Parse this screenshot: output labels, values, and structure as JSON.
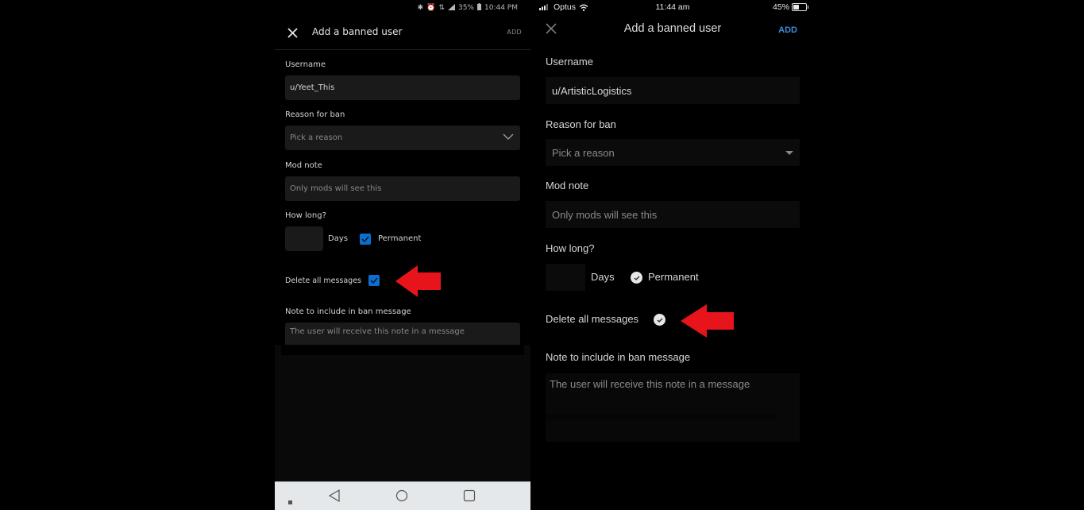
{
  "android": {
    "status_bar": {
      "icons": [
        "bluetooth-icon",
        "alarm-icon",
        "data-icon",
        "signal-icon"
      ],
      "battery": "35%",
      "time": "10:44 PM"
    },
    "header": {
      "close_icon": "close-icon",
      "title": "Add a banned user",
      "add_label": "ADD"
    },
    "form": {
      "username_label": "Username",
      "username_value": "u/Yeet_This",
      "reason_label": "Reason for ban",
      "reason_placeholder": "Pick a reason",
      "mod_note_label": "Mod note",
      "mod_note_placeholder": "Only mods will see this",
      "how_long_label": "How long?",
      "days_value": "",
      "days_label": "Days",
      "permanent_label": "Permanent",
      "permanent_checked": true,
      "delete_messages_label": "Delete all messages",
      "delete_messages_checked": true,
      "note_label": "Note to include in ban message",
      "note_placeholder": "The user will receive this note in a message"
    },
    "nav_bar": [
      "menu-dot",
      "back-icon",
      "home-icon",
      "recents-icon"
    ],
    "colors": {
      "checkbox": "#0c6fcf",
      "arrow": "#e8141c"
    }
  },
  "ios": {
    "status_bar": {
      "carrier": "Optus",
      "time": "11:44 am",
      "battery": "45%",
      "battery_fraction": 0.45
    },
    "header": {
      "close_icon": "close-icon",
      "title": "Add a banned user",
      "add_label": "ADD"
    },
    "form": {
      "username_label": "Username",
      "username_value": "u/ArtisticLogistics",
      "reason_label": "Reason for ban",
      "reason_placeholder": "Pick a reason",
      "mod_note_label": "Mod note",
      "mod_note_placeholder": "Only mods will see this",
      "how_long_label": "How long?",
      "days_value": "",
      "days_label": "Days",
      "permanent_label": "Permanent",
      "permanent_checked": true,
      "delete_messages_label": "Delete all messages",
      "delete_messages_checked": true,
      "note_label": "Note to include in ban message",
      "note_placeholder": "The user will receive this note in a message"
    },
    "colors": {
      "add": "#3d8ddc",
      "arrow": "#e8141c"
    }
  }
}
